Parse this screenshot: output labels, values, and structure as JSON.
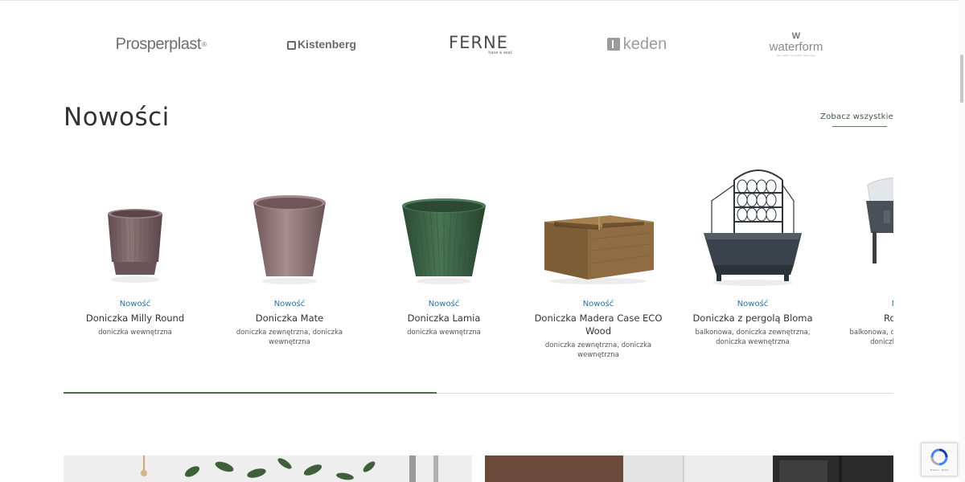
{
  "brands": {
    "prosperplast": "Prosperplast",
    "prosperplast_mark": "®",
    "kistenberg": "Kistenberg",
    "ferne": "FERNE",
    "ferne_tagline": "have a seat.",
    "keden": "keden",
    "waterform": "waterform",
    "waterform_tagline": "the water for better tomorrow"
  },
  "section": {
    "title": "Nowości",
    "see_all": "Zobacz wszystkie"
  },
  "products": [
    {
      "badge": "Nowość",
      "name": "Doniczka Milly Round",
      "category": "doniczka wewnętrzna",
      "color": "#7d6568"
    },
    {
      "badge": "Nowość",
      "name": "Doniczka Mate",
      "category": "doniczka zewnętrzna, doniczka wewnętrzna",
      "color": "#8c7274"
    },
    {
      "badge": "Nowość",
      "name": "Doniczka Lamia",
      "category": "doniczka wewnętrzna",
      "color": "#3f6747"
    },
    {
      "badge": "Nowość",
      "name": "Doniczka Madera Case ECO Wood",
      "category": "doniczka zewnętrzna, doniczka wewnętrzna",
      "color": "#8a6840"
    },
    {
      "badge": "Nowość",
      "name": "Doniczka z pergolą Bloma",
      "category": "balkonowa, doniczka zewnętrzna, doniczka wewnętrzna",
      "color": "#3c4650"
    },
    {
      "badge": "Nowość",
      "name": "Rozsadnik",
      "category": "balkonowa, doniczka zewnętrzna, doniczka wewnętrzna",
      "color": "#4a5058"
    }
  ],
  "carousel_progress": 0.45,
  "colors": {
    "accent_green": "#4f6b50",
    "badge_blue": "#2c6f9c"
  },
  "recaptcha": {
    "label": "Privacy - Terms"
  }
}
